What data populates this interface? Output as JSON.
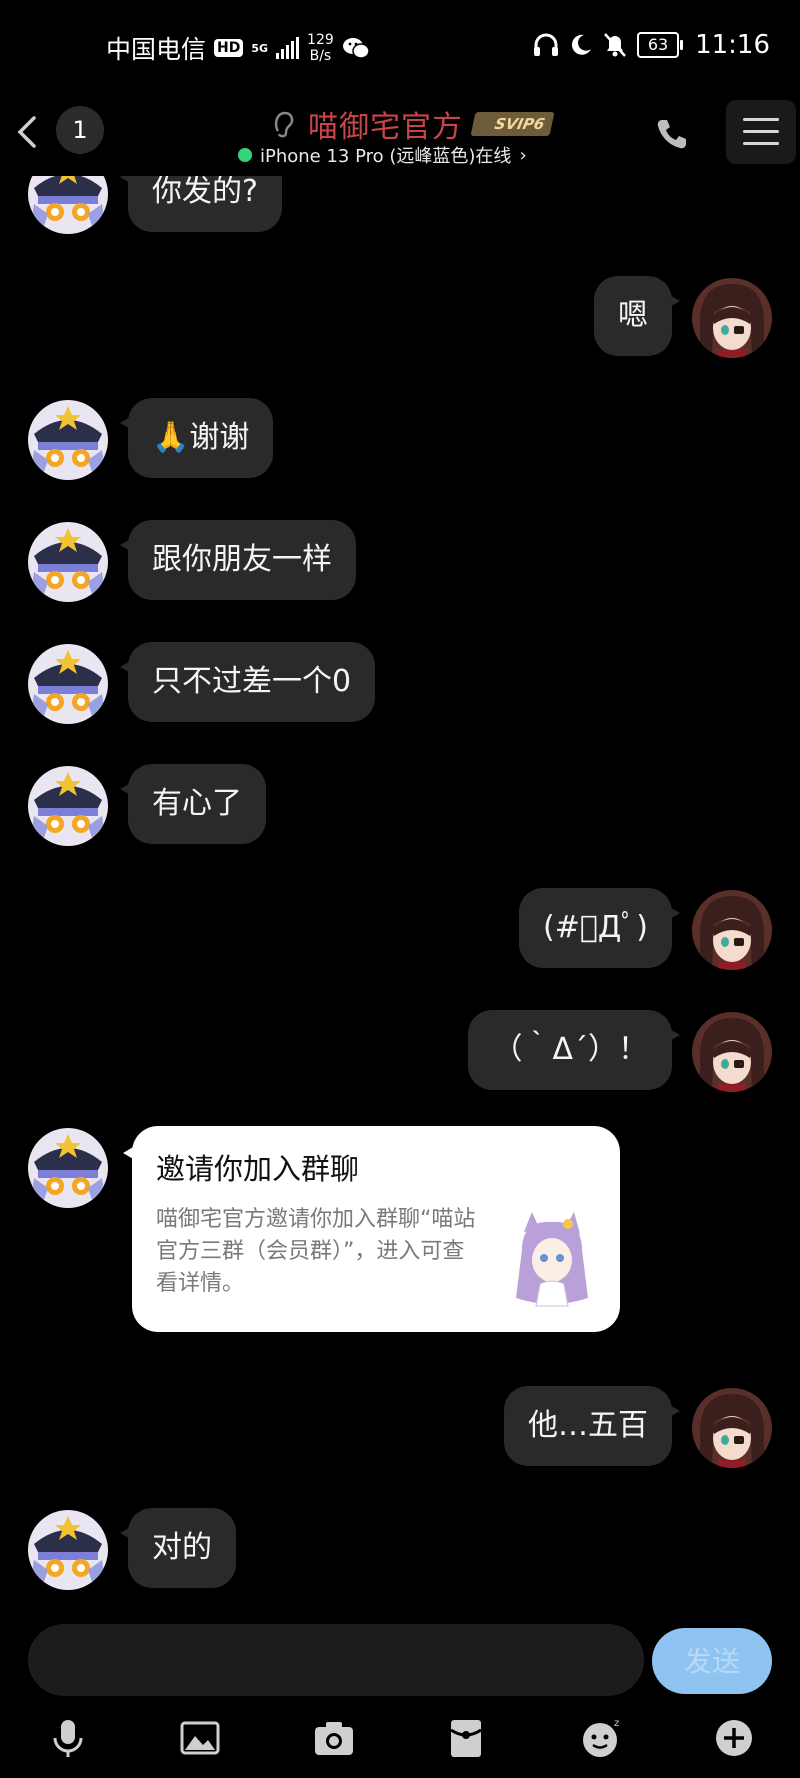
{
  "status_bar": {
    "carrier": "中国电信",
    "hd": "HD",
    "network": "5G",
    "speed_value": "129",
    "speed_unit": "B/s",
    "battery": "63",
    "time": "11:16"
  },
  "header": {
    "unread_count": "1",
    "title": "喵御宅官方",
    "vip_badge": "SVIP6",
    "device_status": "iPhone 13 Pro (远峰蓝色)在线",
    "device_chevron": "›"
  },
  "messages": [
    {
      "side": "left",
      "text": "你发的?"
    },
    {
      "side": "right",
      "text": "嗯"
    },
    {
      "side": "left",
      "text": "🙏谢谢"
    },
    {
      "side": "left",
      "text": "跟你朋友一样"
    },
    {
      "side": "left",
      "text": "只不过差一个0"
    },
    {
      "side": "left",
      "text": "有心了"
    },
    {
      "side": "right",
      "text": "(#ﾟДﾟ)"
    },
    {
      "side": "right",
      "text": "（｀Δ´）！"
    },
    {
      "side": "right",
      "text": "他…五百"
    },
    {
      "side": "left",
      "text": "对的"
    }
  ],
  "invite_card": {
    "title": "邀请你加入群聊",
    "description": "喵御宅官方邀请你加入群聊“喵站官方三群（会员群）”，进入可查看详情。"
  },
  "input": {
    "send_label": "发送"
  },
  "colors": {
    "background": "#000000",
    "bubble": "#2a2a2a",
    "title_red": "#c7444a",
    "online_green": "#35d47a",
    "send_blue": "#8fc3f2"
  },
  "toolbar_icons": [
    "microphone-icon",
    "image-icon",
    "camera-icon",
    "red-packet-icon",
    "emoji-icon",
    "plus-icon"
  ]
}
